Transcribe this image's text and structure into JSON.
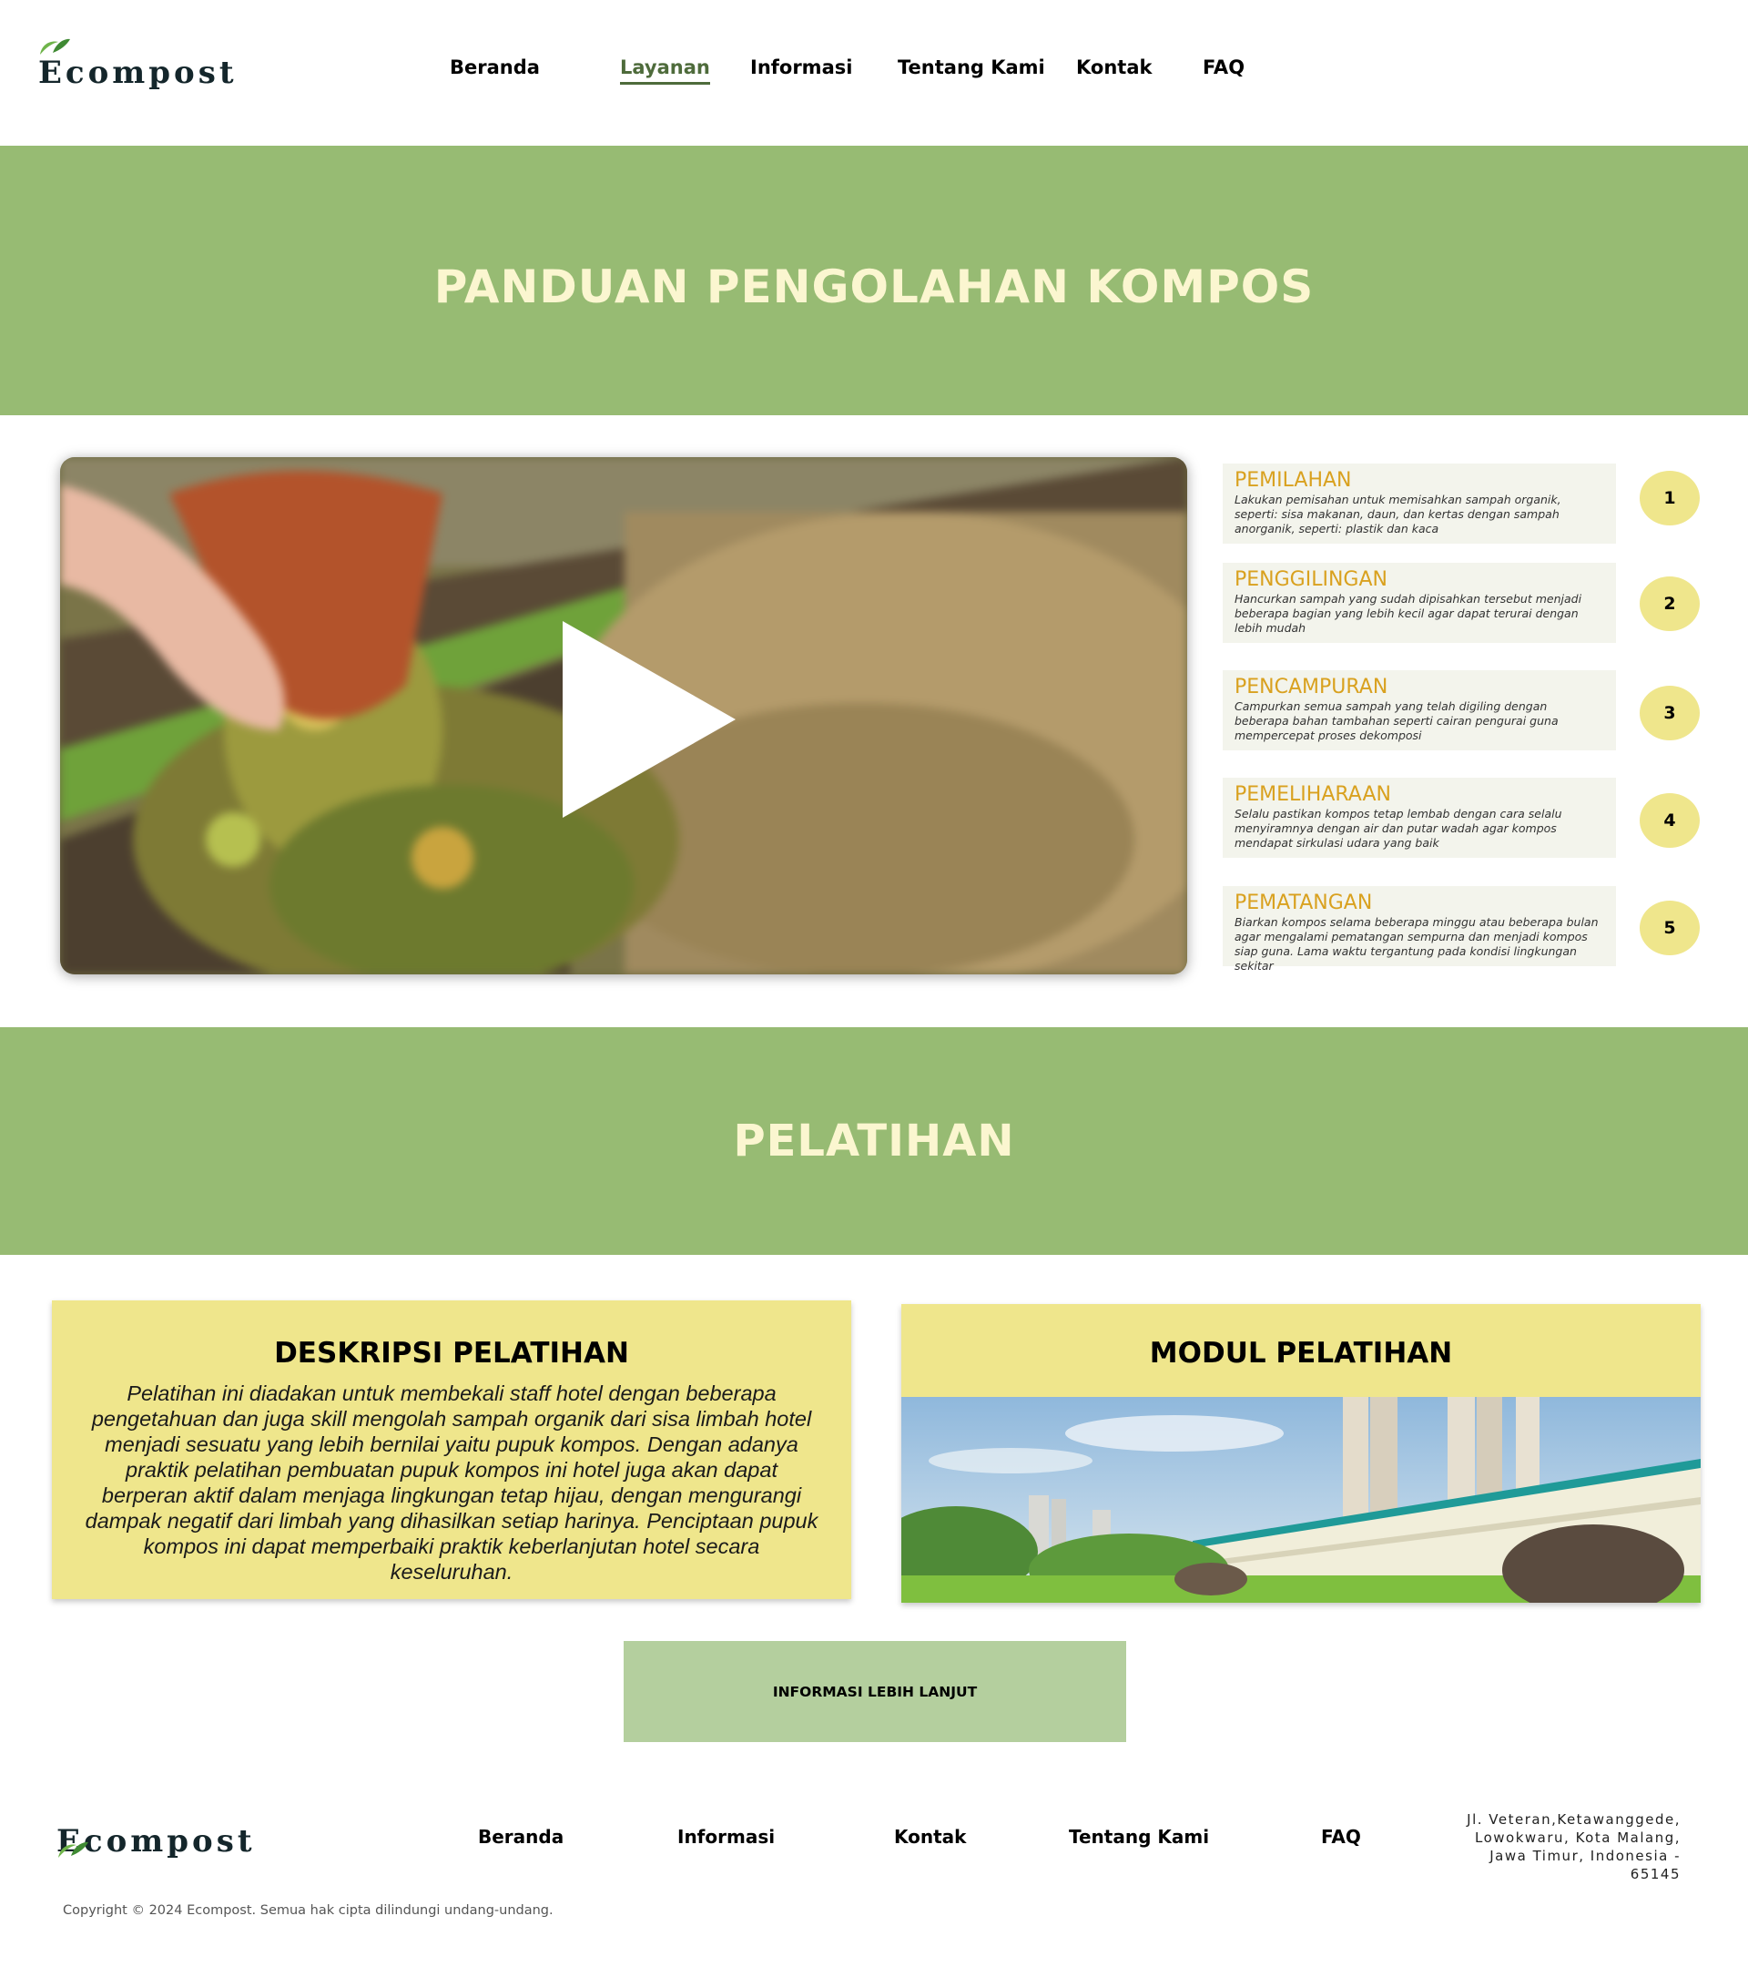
{
  "brand": {
    "name": "Ecompost",
    "leaf_color": "#4e9a3a",
    "text_color": "#14262b"
  },
  "nav": {
    "items": [
      "Beranda",
      "Layanan",
      "Informasi",
      "Tentang Kami",
      "Kontak",
      "FAQ"
    ],
    "active": "Layanan"
  },
  "guide": {
    "title": "PANDUAN PENGOLAHAN KOMPOS",
    "video": {
      "play_icon": "play-icon"
    },
    "steps": [
      {
        "number": "1",
        "title": "PEMILAHAN",
        "desc": "Lakukan pemisahan untuk memisahkan sampah organik, seperti: sisa makanan, daun, dan kertas dengan sampah anorganik, seperti: plastik dan kaca"
      },
      {
        "number": "2",
        "title": "PENGGILINGAN",
        "desc": "Hancurkan sampah yang sudah dipisahkan tersebut menjadi beberapa bagian yang lebih kecil agar dapat terurai dengan lebih mudah"
      },
      {
        "number": "3",
        "title": "PENCAMPURAN",
        "desc": "Campurkan semua sampah yang telah digiling dengan beberapa bahan tambahan seperti cairan pengurai guna mempercepat proses dekomposi"
      },
      {
        "number": "4",
        "title": "PEMELIHARAAN",
        "desc": "Selalu pastikan kompos tetap lembab dengan cara selalu menyiramnya dengan air dan putar wadah agar kompos mendapat sirkulasi udara yang baik"
      },
      {
        "number": "5",
        "title": "PEMATANGAN",
        "desc": "Biarkan kompos selama beberapa minggu atau beberapa bulan agar mengalami pematangan sempurna dan menjadi kompos siap guna. Lama waktu tergantung pada kondisi lingkungan sekitar"
      }
    ]
  },
  "training": {
    "title": "PELATIHAN",
    "description_title": "DESKRIPSI PELATIHAN",
    "description_body": "Pelatihan ini diadakan untuk membekali staff hotel dengan beberapa pengetahuan dan juga skill mengolah sampah organik dari sisa limbah hotel menjadi sesuatu yang lebih bernilai yaitu pupuk kompos.  Dengan adanya praktik pelatihan pembuatan  pupuk kompos ini hotel juga akan dapat berperan aktif dalam menjaga lingkungan tetap hijau, dengan mengurangi dampak negatif dari limbah yang dihasilkan setiap harinya. Penciptaan pupuk kompos ini dapat memperbaiki praktik keberlanjutan hotel secara keseluruhan.",
    "module_title": "MODUL PELATIHAN",
    "more_button": "INFORMASI LEBIH LANJUT"
  },
  "footer": {
    "links": [
      "Beranda",
      "Informasi",
      "Kontak",
      "Tentang Kami",
      "FAQ"
    ],
    "address": "Jl. Veteran,Ketawanggede, Lowokwaru, Kota Malang, Jawa Timur, Indonesia - 65145",
    "copyright": "Copyright © 2024 Ecompost. Semua hak cipta dilindungi undang-undang."
  },
  "colors": {
    "band_green": "#97bb73",
    "band_title": "#fbf6d0",
    "step_title": "#d9a11f",
    "step_card": "#f3f4ec",
    "yellow": "#efe68c",
    "button_green": "#b4cf9e",
    "active_nav": "#4e6b3b"
  }
}
